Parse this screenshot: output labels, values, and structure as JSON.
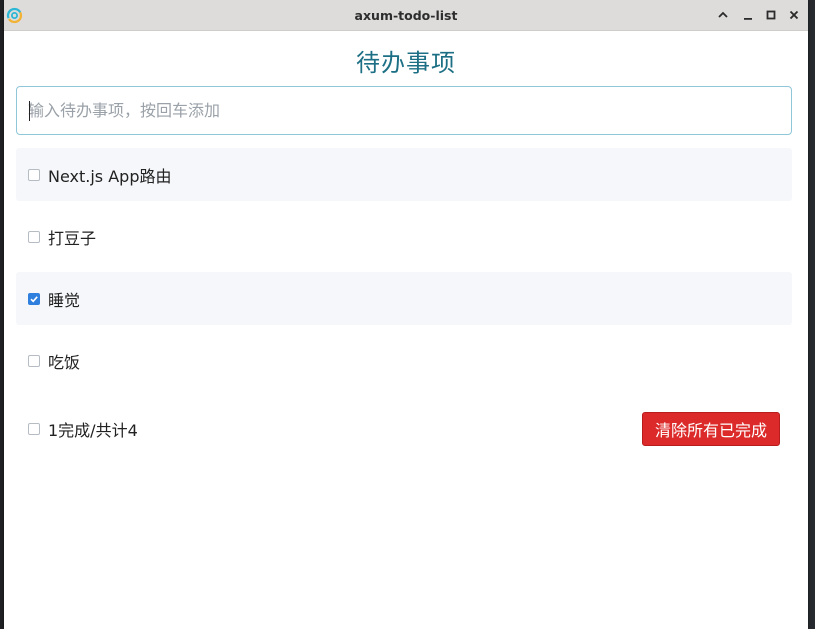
{
  "window": {
    "title": "axum-todo-list",
    "app_icon": "app-logo-icon",
    "controls": [
      "chevron-up-icon",
      "minimize-icon",
      "maximize-icon",
      "close-icon"
    ]
  },
  "heading": "待办事项",
  "input": {
    "value": "",
    "placeholder": "输入待办事项，按回车添加"
  },
  "todos": [
    {
      "text": "Next.js App路由",
      "done": false
    },
    {
      "text": "打豆子",
      "done": false
    },
    {
      "text": "睡觉",
      "done": true
    },
    {
      "text": "吃饭",
      "done": false
    }
  ],
  "footer": {
    "summary": "1完成/共计4",
    "select_all_checked": false,
    "clear_button": "清除所有已完成"
  },
  "colors": {
    "heading": "#1c6f84",
    "input_border": "#8fc6d8",
    "checkbox_checked": "#2f7fde",
    "danger_button": "#dc2a2a",
    "row_shade": "#f5f7fa"
  }
}
